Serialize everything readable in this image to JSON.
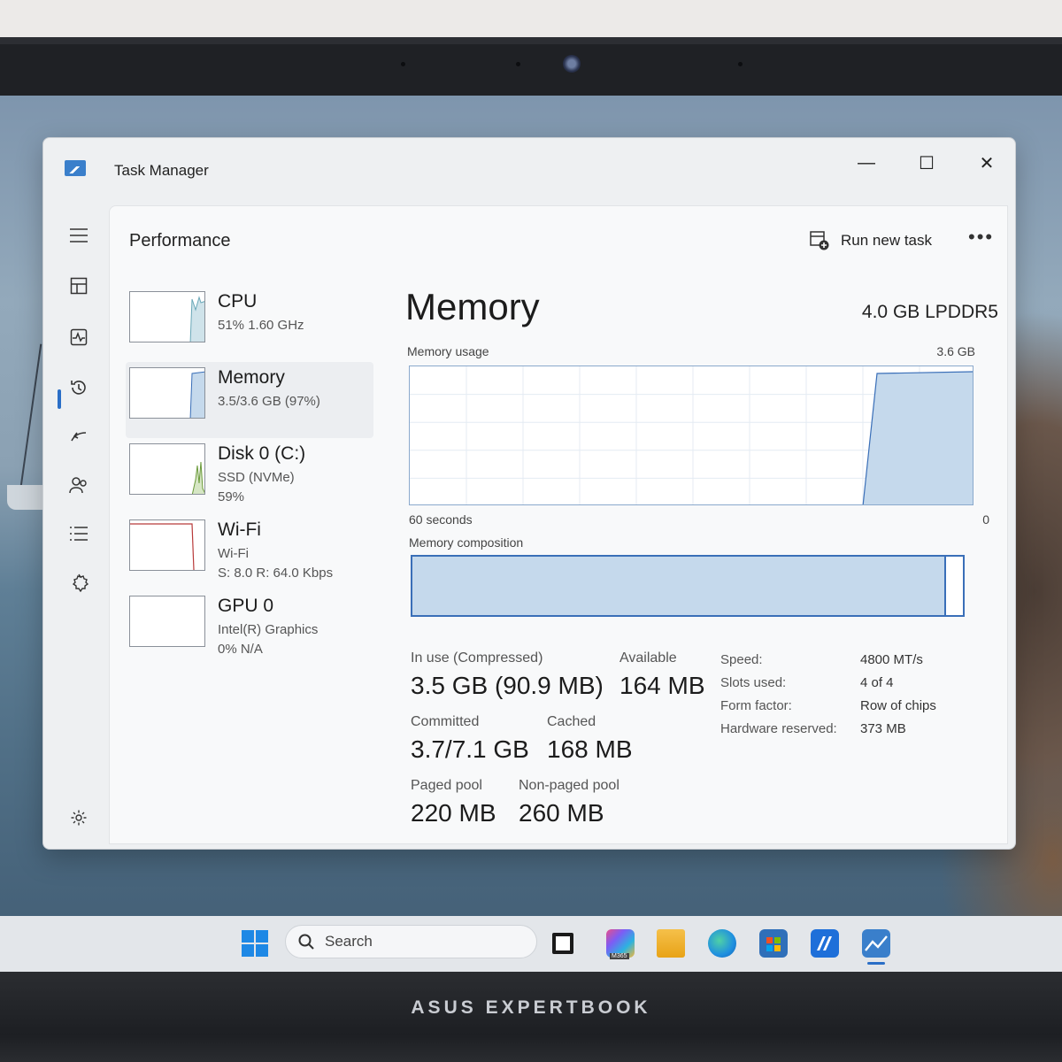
{
  "device_brand": "ASUS EXPERTBOOK",
  "window": {
    "title": "Task Manager",
    "controls": {
      "minimize": "—",
      "maximize": "☐",
      "close": "✕"
    }
  },
  "header": {
    "page_title": "Performance",
    "run_new_task": "Run new task",
    "more": "•••"
  },
  "devices": [
    {
      "name": "CPU",
      "line1": "51%  1.60 GHz",
      "line2": ""
    },
    {
      "name": "Memory",
      "line1": "3.5/3.6 GB (97%)",
      "line2": ""
    },
    {
      "name": "Disk 0 (C:)",
      "line1": "SSD (NVMe)",
      "line2": "59%"
    },
    {
      "name": "Wi-Fi",
      "line1": "Wi-Fi",
      "line2": "S: 8.0  R: 64.0 Kbps"
    },
    {
      "name": "GPU 0",
      "line1": "Intel(R) Graphics",
      "line2": "0%  N/A"
    }
  ],
  "memory": {
    "title": "Memory",
    "type": "4.0 GB LPDDR5",
    "usage_label": "Memory usage",
    "usage_max": "3.6 GB",
    "x_left": "60 seconds",
    "x_right": "0",
    "composition_label": "Memory composition",
    "composition_in_use_fraction": 0.97,
    "stats": {
      "in_use_label": "In use (Compressed)",
      "in_use_value": "3.5 GB (90.9 MB)",
      "available_label": "Available",
      "available_value": "164 MB",
      "committed_label": "Committed",
      "committed_value": "3.7/7.1 GB",
      "cached_label": "Cached",
      "cached_value": "168 MB",
      "paged_label": "Paged pool",
      "paged_value": "220 MB",
      "nonpaged_label": "Non-paged pool",
      "nonpaged_value": "260 MB"
    },
    "specs": [
      {
        "label": "Speed:",
        "value": "4800 MT/s"
      },
      {
        "label": "Slots used:",
        "value": "4 of 4"
      },
      {
        "label": "Form factor:",
        "value": "Row of chips"
      },
      {
        "label": "Hardware reserved:",
        "value": "373 MB"
      }
    ]
  },
  "taskbar": {
    "search_placeholder": "Search",
    "m365_label": "M365"
  },
  "colors": {
    "accent": "#2a6ec7",
    "graph_fill": "#c5d9ec",
    "graph_line": "#3a6fb8"
  }
}
